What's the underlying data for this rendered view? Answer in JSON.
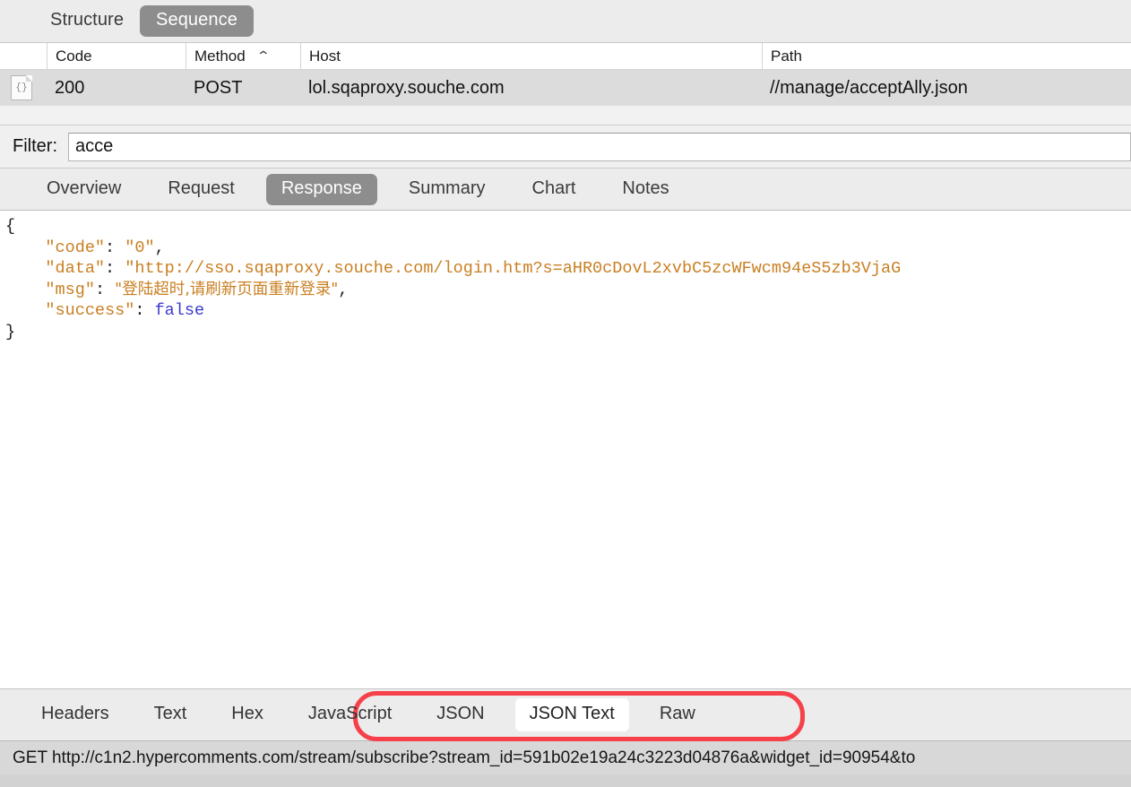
{
  "toolbar": {
    "segments": [
      {
        "label": "Structure",
        "active": false
      },
      {
        "label": "Sequence",
        "active": true
      }
    ]
  },
  "table": {
    "columns": [
      {
        "key": "icon",
        "label": ""
      },
      {
        "key": "code",
        "label": "Code"
      },
      {
        "key": "method",
        "label": "Method",
        "sort": "asc",
        "sort_glyph": "⌃"
      },
      {
        "key": "host",
        "label": "Host"
      },
      {
        "key": "path",
        "label": "Path"
      }
    ],
    "rows": [
      {
        "icon": "json-document-icon",
        "icon_glyph": "{}",
        "code": "200",
        "method": "POST",
        "host": "lol.sqaproxy.souche.com",
        "path": "//manage/acceptAlly.json",
        "selected": true
      }
    ]
  },
  "filter": {
    "label": "Filter:",
    "value": "acce",
    "placeholder": ""
  },
  "main_tabs": [
    {
      "label": "Overview",
      "active": false
    },
    {
      "label": "Request",
      "active": false
    },
    {
      "label": "Response",
      "active": true
    },
    {
      "label": "Summary",
      "active": false
    },
    {
      "label": "Chart",
      "active": false
    },
    {
      "label": "Notes",
      "active": false
    }
  ],
  "response_body": {
    "lines": [
      {
        "indent": 0,
        "parts": [
          {
            "t": "{",
            "c": "p"
          }
        ]
      },
      {
        "indent": 1,
        "parts": [
          {
            "t": "\"code\"",
            "c": "k"
          },
          {
            "t": ": ",
            "c": "p"
          },
          {
            "t": "\"0\"",
            "c": "s"
          },
          {
            "t": ",",
            "c": "p"
          }
        ]
      },
      {
        "indent": 1,
        "parts": [
          {
            "t": "\"data\"",
            "c": "k"
          },
          {
            "t": ": ",
            "c": "p"
          },
          {
            "t": "\"http://sso.sqaproxy.souche.com/login.htm?s=aHR0cDovL2xvbC5zcWFwcm94eS5zb3VjaG",
            "c": "s"
          }
        ]
      },
      {
        "indent": 1,
        "parts": [
          {
            "t": "\"msg\"",
            "c": "k"
          },
          {
            "t": ": ",
            "c": "p"
          },
          {
            "t": "\"登陆超时,请刷新页面重新登录\"",
            "c": "s cjk"
          },
          {
            "t": ",",
            "c": "p"
          }
        ]
      },
      {
        "indent": 1,
        "parts": [
          {
            "t": "\"success\"",
            "c": "k"
          },
          {
            "t": ": ",
            "c": "p"
          },
          {
            "t": "false",
            "c": "b"
          }
        ]
      },
      {
        "indent": 0,
        "parts": [
          {
            "t": "}",
            "c": "p"
          }
        ]
      }
    ],
    "values": {
      "code": "0",
      "data": "http://sso.sqaproxy.souche.com/login.htm?s=aHR0cDovL2xvbC5zcWFwcm94eS5zb3VjaG",
      "msg": "登陆超时,请刷新页面重新登录",
      "success": "false"
    }
  },
  "bottom_tabs": [
    {
      "label": "Headers",
      "active": false,
      "highlighted": false
    },
    {
      "label": "Text",
      "active": false,
      "highlighted": false
    },
    {
      "label": "Hex",
      "active": false,
      "highlighted": false
    },
    {
      "label": "JavaScript",
      "active": false,
      "highlighted": true
    },
    {
      "label": "JSON",
      "active": false,
      "highlighted": true
    },
    {
      "label": "JSON Text",
      "active": true,
      "highlighted": true
    },
    {
      "label": "Raw",
      "active": false,
      "highlighted": false
    }
  ],
  "annotation": {
    "shape": "rounded-rectangle",
    "color": "#f6404a"
  },
  "statusbar": {
    "text": "GET http://c1n2.hypercomments.com/stream/subscribe?stream_id=591b02e19a24c3223d04876a&widget_id=90954&to"
  },
  "colors": {
    "accent_selected": "#8d8d8d",
    "row_selected": "#dcdcdc",
    "json_string": "#c97f22",
    "json_boolean": "#3a3ad0",
    "annotation_red": "#f6404a",
    "toolbar_bg": "#ececec",
    "statusbar_bg": "#d8d8d8"
  }
}
